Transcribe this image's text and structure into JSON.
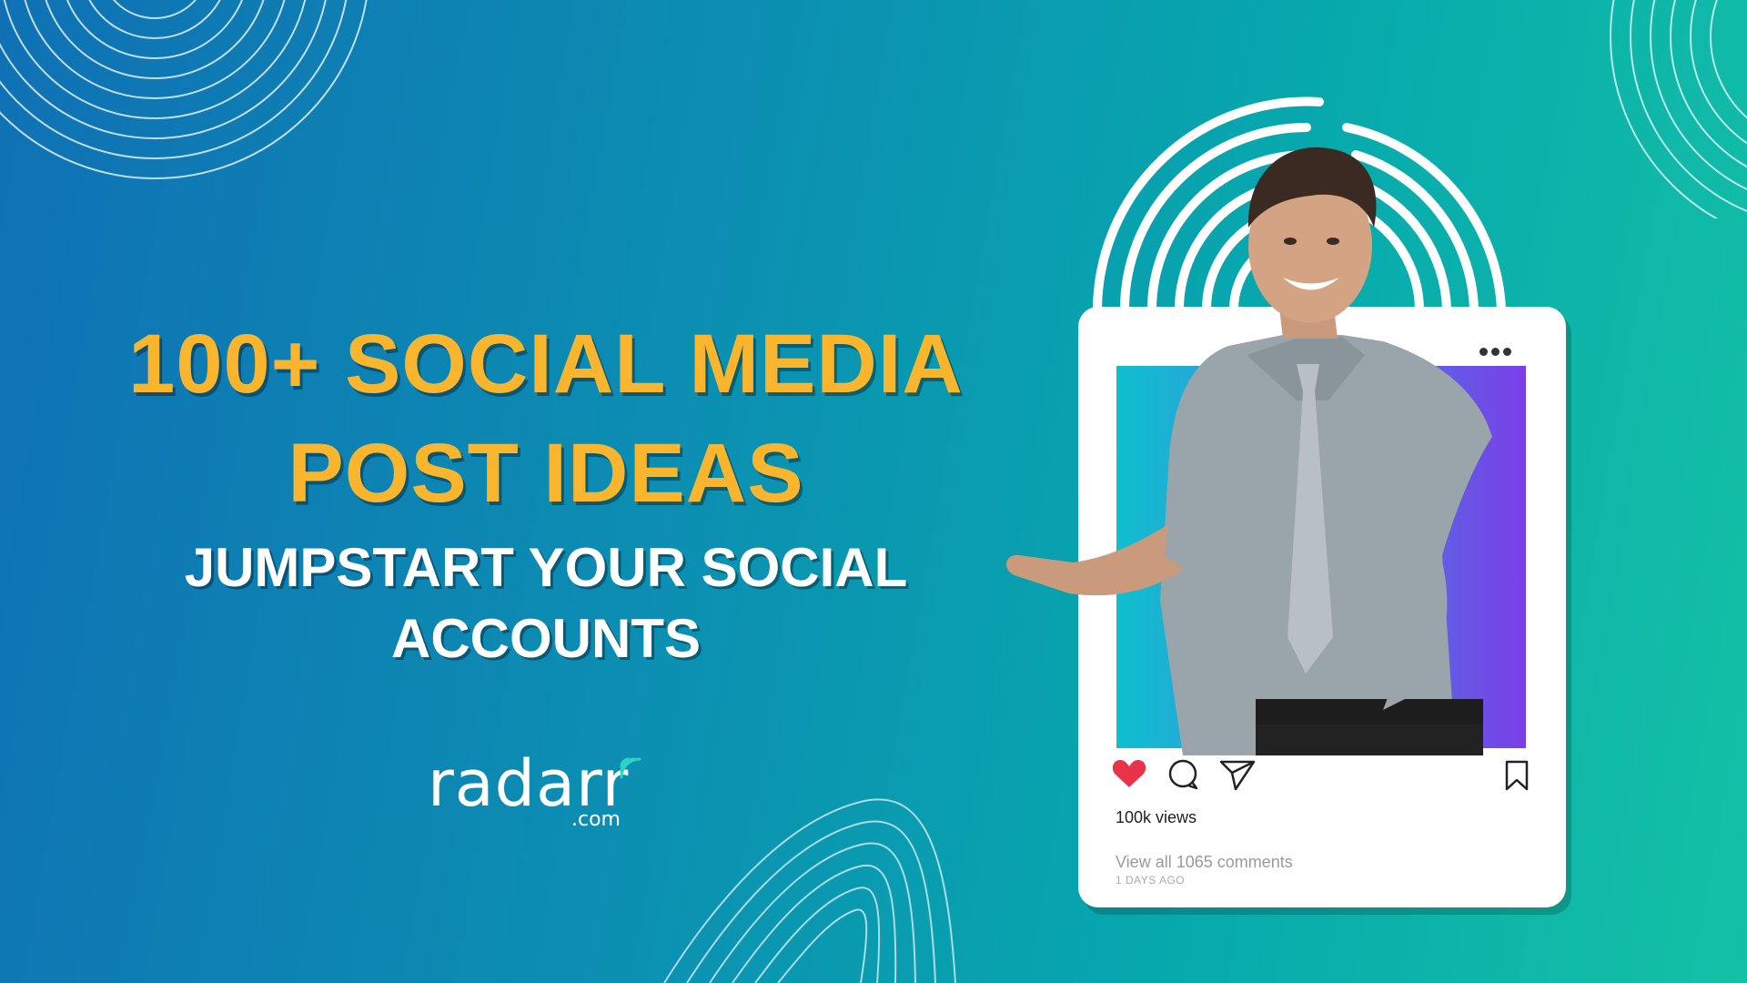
{
  "headline": {
    "line1": "100+ SOCIAL MEDIA",
    "line2": "POST IDEAS"
  },
  "subheadline": {
    "line1": "JUMPSTART YOUR SOCIAL",
    "line2": "ACCOUNTS"
  },
  "logo": {
    "word": "radarr",
    "suffix": ".com"
  },
  "post_card": {
    "views": "100k views",
    "comments": "View all 1065 comments",
    "time_ago": "1 DAYS AGO",
    "icons": [
      "heart-icon",
      "comment-icon",
      "send-icon",
      "bookmark-icon",
      "more-icon"
    ]
  },
  "colors": {
    "headline": "#f8b52d",
    "heart": "#e8334a",
    "background_start": "#0f71b4",
    "background_end": "#14c1a5"
  }
}
